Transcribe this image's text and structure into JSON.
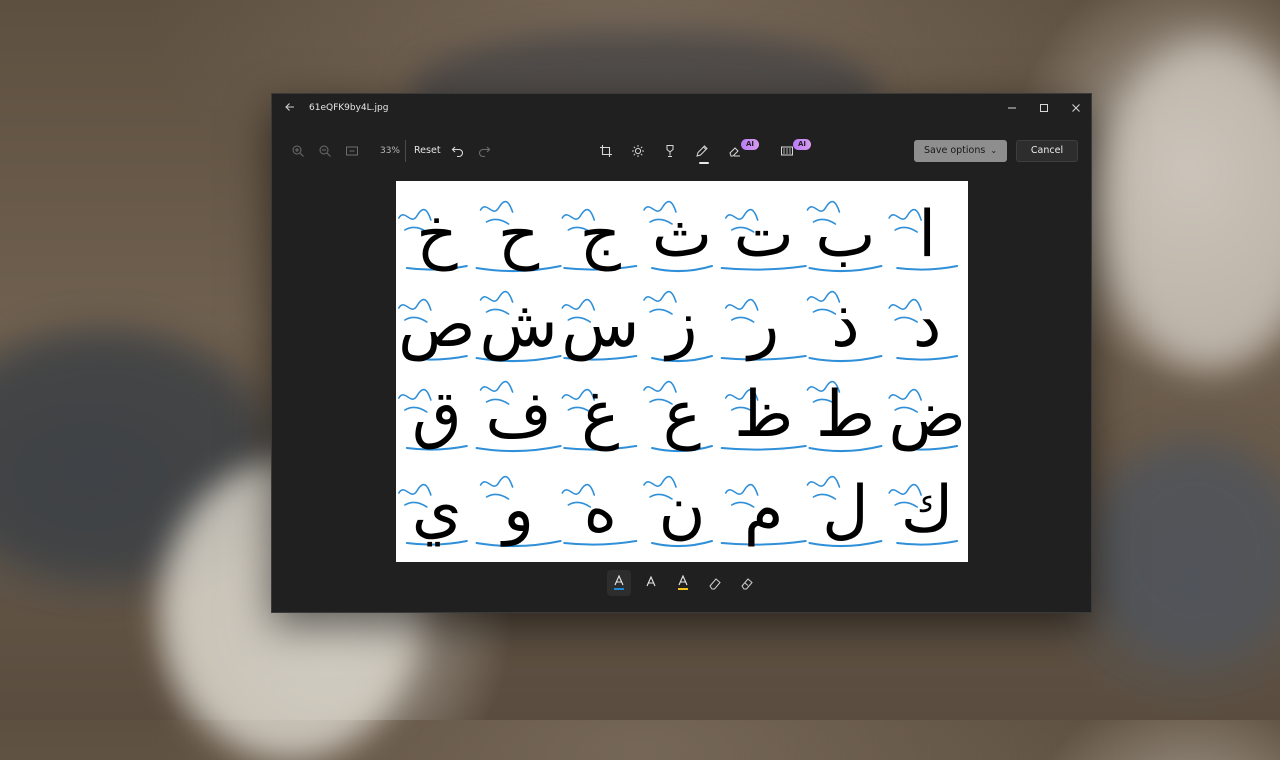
{
  "window": {
    "title": "61eQFK9by4L.jpg"
  },
  "titlebar": {
    "back_icon": "back-arrow-icon",
    "minimize_icon": "minimize-icon",
    "maximize_icon": "maximize-icon",
    "close_icon": "close-icon"
  },
  "toolbar": {
    "zoom_in_icon": "zoom-in-icon",
    "zoom_out_icon": "zoom-out-icon",
    "fit_icon": "fit-to-window-icon",
    "zoom_level": "33%",
    "reset_label": "Reset",
    "undo_icon": "undo-icon",
    "redo_icon": "redo-icon",
    "crop_icon": "crop-icon",
    "adjust_icon": "brightness-icon",
    "filter_icon": "filter-icon",
    "markup_icon": "markup-pen-icon",
    "erase_badge": "AI",
    "background_badge": "AI",
    "save_label": "Save options",
    "cancel_label": "Cancel"
  },
  "pens": [
    {
      "name": "ballpoint-pen",
      "color": "#1e88d8",
      "active": true
    },
    {
      "name": "highlighter-pen",
      "color": "#e8e8e8",
      "active": false
    },
    {
      "name": "marker-pen",
      "color": "#f2c21b",
      "active": false
    },
    {
      "name": "eraser",
      "color": "#cfcfcf",
      "active": false
    },
    {
      "name": "erase-all",
      "color": "#cfcfcf",
      "active": false
    }
  ],
  "canvas": {
    "ink_color": "#2f8fd8",
    "letters_rows": [
      [
        "ا",
        "ب",
        "ت",
        "ث",
        "ج",
        "ح",
        "خ"
      ],
      [
        "د",
        "ذ",
        "ر",
        "ز",
        "س",
        "ش",
        "ص"
      ],
      [
        "ض",
        "ط",
        "ظ",
        "ع",
        "غ",
        "ف",
        "ق"
      ],
      [
        "ك",
        "ل",
        "م",
        "ن",
        "ه",
        "و",
        "ي"
      ]
    ]
  }
}
